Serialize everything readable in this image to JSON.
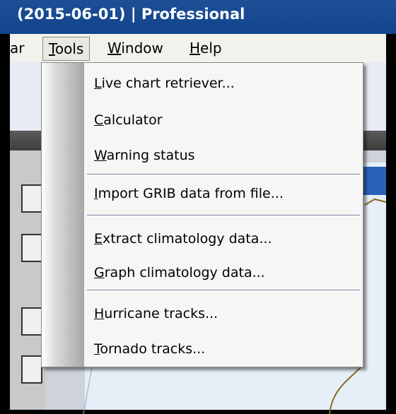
{
  "window": {
    "title": "(2015-06-01) | Professional"
  },
  "menu_bar": {
    "items": [
      {
        "label": "ar",
        "underline_index": -1
      },
      {
        "label": "Tools",
        "underline_index": 0
      },
      {
        "label": "Window",
        "underline_index": 0
      },
      {
        "label": "Help",
        "underline_index": 0
      }
    ]
  },
  "tools_menu": {
    "items": [
      {
        "pre": "",
        "u": "L",
        "post": "ive chart retriever..."
      },
      {
        "pre": "",
        "u": "C",
        "post": "alculator"
      },
      {
        "pre": "",
        "u": "W",
        "post": "arning status"
      },
      {
        "pre": "",
        "u": "I",
        "post": "mport GRIB data from file..."
      },
      {
        "pre": "",
        "u": "E",
        "post": "xtract climatology data..."
      },
      {
        "pre": "",
        "u": "G",
        "post": "raph climatology data..."
      },
      {
        "pre": "",
        "u": "H",
        "post": "urricane tracks..."
      },
      {
        "pre": "",
        "u": "T",
        "post": "ornado tracks..."
      }
    ]
  }
}
